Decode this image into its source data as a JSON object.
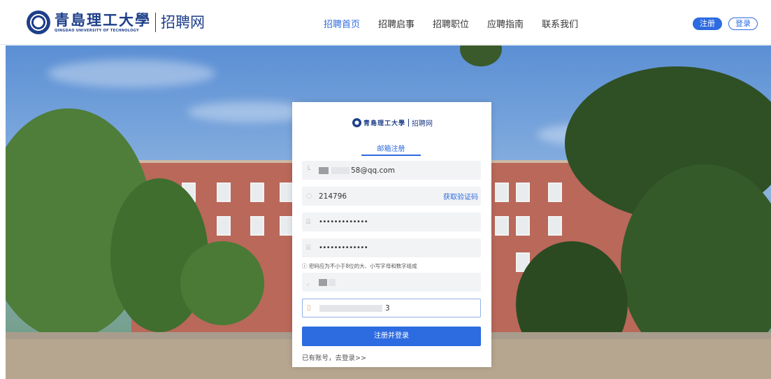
{
  "header": {
    "logo_cn": "青島理工大學",
    "logo_en": "QINGDAO UNIVERSITY OF TECHNOLOGY",
    "site_name": "招聘网",
    "nav": [
      "招聘首页",
      "招聘启事",
      "招聘职位",
      "应聘指南",
      "联系我们"
    ],
    "active_nav": "招聘首页",
    "register_label": "注册",
    "login_label": "登录"
  },
  "form": {
    "logo_cn": "青島理工大學",
    "site_name": "招聘网",
    "tab_label": "邮箱注册",
    "email_value": "58@qq.com",
    "code_value": "214796",
    "get_code_label": "获取验证码",
    "password_value": "•••••••••••••",
    "confirm_password_value": "•••••••••••••",
    "password_hint": "密码应为不小于8位的大、小写字母和数字组成",
    "id_suffix": "3",
    "submit_label": "注册并登录",
    "login_link": "已有账号，去登录>>"
  },
  "colors": {
    "primary": "#2d6be0",
    "brand": "#1e3f8a"
  },
  "icons": {
    "hint": "info-circle-icon",
    "code": "shield-icon",
    "password": "lock-icon"
  }
}
